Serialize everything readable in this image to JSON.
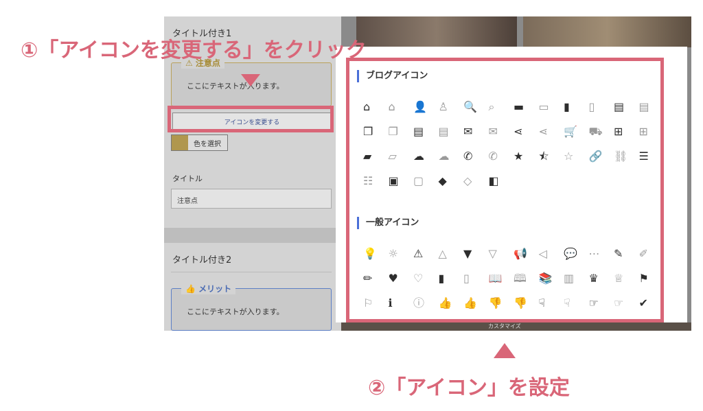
{
  "sidebar": {
    "title1": "タイトル付き1",
    "box1_legend": "⚠ 注意点",
    "box1_body": "ここにテキストが入ります。",
    "change_icon_button": "アイコンを変更する",
    "color_button": "色を選択",
    "title_field_label": "タイトル",
    "title_field_value": "注意点",
    "title2": "タイトル付き2",
    "box2_legend": "👍 メリット",
    "box2_body": "ここにテキストが入ります。"
  },
  "background_text": "カスタマイズ",
  "dialog": {
    "blog_section_title": "ブログアイコン",
    "general_section_title": "一般アイコン",
    "blog_icons": [
      {
        "name": "home-icon",
        "glyph": "⌂",
        "style": "solid"
      },
      {
        "name": "home-outline-icon",
        "glyph": "⌂",
        "style": "outline"
      },
      {
        "name": "user-icon",
        "glyph": "👤",
        "style": "solid"
      },
      {
        "name": "user-outline-icon",
        "glyph": "♙",
        "style": "outline"
      },
      {
        "name": "search-icon",
        "glyph": "🔍",
        "style": "solid"
      },
      {
        "name": "search-outline-icon",
        "glyph": "⌕",
        "style": "outline"
      },
      {
        "name": "folder-icon",
        "glyph": "▬",
        "style": "solid"
      },
      {
        "name": "folder-outline-icon",
        "glyph": "▭",
        "style": "outline"
      },
      {
        "name": "document-icon",
        "glyph": "▮",
        "style": "solid"
      },
      {
        "name": "document-outline-icon",
        "glyph": "▯",
        "style": "outline"
      },
      {
        "name": "clipboard-icon",
        "glyph": "▤",
        "style": "solid"
      },
      {
        "name": "clipboard-outline-icon",
        "glyph": "▤",
        "style": "outline"
      },
      {
        "name": "copy-icon",
        "glyph": "❐",
        "style": "solid"
      },
      {
        "name": "copy-outline-icon",
        "glyph": "❐",
        "style": "outline"
      },
      {
        "name": "list-doc-icon",
        "glyph": "▤",
        "style": "solid"
      },
      {
        "name": "list-doc-outline-icon",
        "glyph": "▤",
        "style": "outline"
      },
      {
        "name": "mail-icon",
        "glyph": "✉",
        "style": "solid"
      },
      {
        "name": "mail-outline-icon",
        "glyph": "✉",
        "style": "outline"
      },
      {
        "name": "share-icon",
        "glyph": "⋖",
        "style": "solid"
      },
      {
        "name": "share-outline-icon",
        "glyph": "⋖",
        "style": "outline"
      },
      {
        "name": "cart-icon",
        "glyph": "🛒",
        "style": "solid"
      },
      {
        "name": "cart-outline-icon",
        "glyph": "⛟",
        "style": "outline"
      },
      {
        "name": "basket-icon",
        "glyph": "⊞",
        "style": "solid"
      },
      {
        "name": "basket-outline-icon",
        "glyph": "⊞",
        "style": "outline"
      },
      {
        "name": "bag-icon",
        "glyph": "▰",
        "style": "solid"
      },
      {
        "name": "bag-outline-icon",
        "glyph": "▱",
        "style": "outline"
      },
      {
        "name": "cloud-icon",
        "glyph": "☁",
        "style": "solid"
      },
      {
        "name": "cloud-outline-icon",
        "glyph": "☁",
        "style": "outline"
      },
      {
        "name": "phone-icon",
        "glyph": "✆",
        "style": "solid"
      },
      {
        "name": "phone-outline-icon",
        "glyph": "✆",
        "style": "outline"
      },
      {
        "name": "star-icon",
        "glyph": "★",
        "style": "solid"
      },
      {
        "name": "star-half-icon",
        "glyph": "⯪",
        "style": "solid"
      },
      {
        "name": "star-outline-icon",
        "glyph": "☆",
        "style": "outline"
      },
      {
        "name": "link-icon",
        "glyph": "🔗",
        "style": "solid"
      },
      {
        "name": "link-outline-icon",
        "glyph": "⛓",
        "style": "outline"
      },
      {
        "name": "list-icon",
        "glyph": "☰",
        "style": "solid"
      },
      {
        "name": "list-outline-icon",
        "glyph": "☷",
        "style": "outline"
      },
      {
        "name": "archive-icon",
        "glyph": "▣",
        "style": "solid"
      },
      {
        "name": "archive-outline-icon",
        "glyph": "▢",
        "style": "outline"
      },
      {
        "name": "tag-icon",
        "glyph": "◆",
        "style": "solid"
      },
      {
        "name": "tag-outline-icon",
        "glyph": "◇",
        "style": "outline"
      },
      {
        "name": "book-open-icon",
        "glyph": "◧",
        "style": "solid"
      }
    ],
    "general_icons": [
      {
        "name": "lightbulb-icon",
        "glyph": "💡",
        "style": "solid"
      },
      {
        "name": "lightbulb-outline-icon",
        "glyph": "☼",
        "style": "outline"
      },
      {
        "name": "warning-icon",
        "glyph": "⚠",
        "style": "solid"
      },
      {
        "name": "warning-outline-icon",
        "glyph": "△",
        "style": "outline"
      },
      {
        "name": "bookmark-icon",
        "glyph": "▼",
        "style": "solid"
      },
      {
        "name": "bookmark-outline-icon",
        "glyph": "▽",
        "style": "outline"
      },
      {
        "name": "megaphone-icon",
        "glyph": "📢",
        "style": "solid"
      },
      {
        "name": "megaphone-outline-icon",
        "glyph": "◁",
        "style": "outline"
      },
      {
        "name": "chat-icon",
        "glyph": "💬",
        "style": "solid"
      },
      {
        "name": "chat-outline-icon",
        "glyph": "⋯",
        "style": "outline"
      },
      {
        "name": "pencil-icon",
        "glyph": "✎",
        "style": "solid"
      },
      {
        "name": "pencil-outline-icon",
        "glyph": "✐",
        "style": "outline"
      },
      {
        "name": "pen-icon",
        "glyph": "✏",
        "style": "solid"
      },
      {
        "name": "heart-icon",
        "glyph": "♥",
        "style": "solid"
      },
      {
        "name": "heart-outline-icon",
        "glyph": "♡",
        "style": "outline"
      },
      {
        "name": "notebook-icon",
        "glyph": "▮",
        "style": "solid"
      },
      {
        "name": "notebook-outline-icon",
        "glyph": "▯",
        "style": "outline"
      },
      {
        "name": "book-icon",
        "glyph": "📖",
        "style": "solid"
      },
      {
        "name": "book-outline-icon",
        "glyph": "🕮",
        "style": "outline"
      },
      {
        "name": "books-icon",
        "glyph": "📚",
        "style": "solid"
      },
      {
        "name": "books-outline-icon",
        "glyph": "▥",
        "style": "outline"
      },
      {
        "name": "crown-icon",
        "glyph": "♛",
        "style": "solid"
      },
      {
        "name": "crown-outline-icon",
        "glyph": "♕",
        "style": "outline"
      },
      {
        "name": "flag-icon",
        "glyph": "⚑",
        "style": "solid"
      },
      {
        "name": "flag-outline-icon",
        "glyph": "⚐",
        "style": "outline"
      },
      {
        "name": "info-icon",
        "glyph": "ℹ",
        "style": "solid"
      },
      {
        "name": "info-outline-icon",
        "glyph": "ⓘ",
        "style": "outline"
      },
      {
        "name": "thumbs-up-icon",
        "glyph": "👍",
        "style": "solid"
      },
      {
        "name": "thumbs-up-outline-icon",
        "glyph": "👍",
        "style": "outline"
      },
      {
        "name": "thumbs-down-icon",
        "glyph": "👎",
        "style": "solid"
      },
      {
        "name": "thumbs-down-outline-icon",
        "glyph": "👎",
        "style": "outline"
      },
      {
        "name": "hand-down-icon",
        "glyph": "☟",
        "style": "solid"
      },
      {
        "name": "hand-down-outline-icon",
        "glyph": "☟",
        "style": "outline"
      },
      {
        "name": "hand-right-icon",
        "glyph": "☞",
        "style": "solid"
      },
      {
        "name": "hand-right-outline-icon",
        "glyph": "☞",
        "style": "outline"
      },
      {
        "name": "check-circle-icon",
        "glyph": "✔",
        "style": "solid"
      }
    ]
  },
  "annotations": {
    "step1": "①「アイコンを変更する」をクリック",
    "step2": "②「アイコン」を設定"
  },
  "colors": {
    "accent_pink": "#d96678",
    "section_bar_blue": "#4a6fd8",
    "caution_gold": "#b9a05a",
    "merit_blue": "#5b7ec5"
  }
}
